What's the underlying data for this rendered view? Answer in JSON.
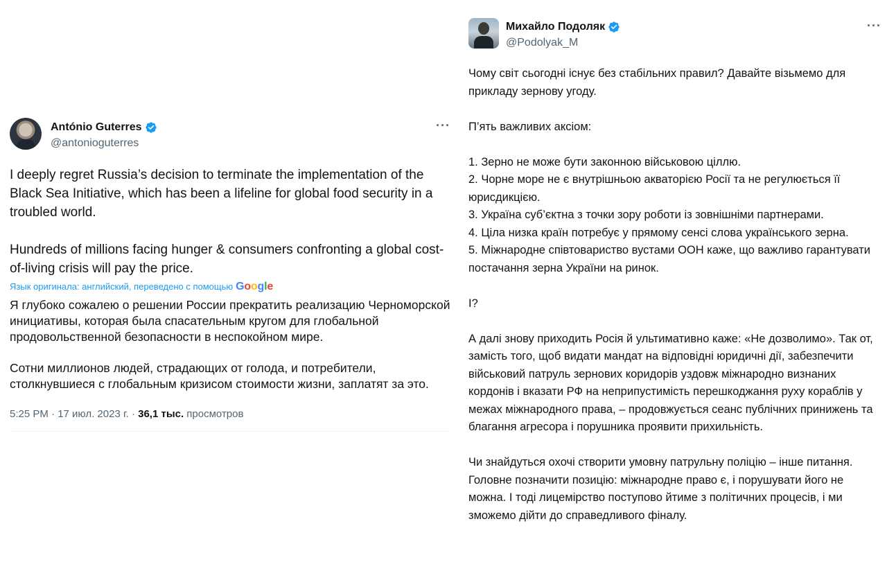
{
  "left_tweet": {
    "name": "António Guterres",
    "handle": "@antonioguterres",
    "more": "···",
    "para1": "I deeply regret Russia’s decision to terminate the implementation of the Black Sea Initiative, which has been a lifeline for global food security in a troubled world.",
    "para2": "Hundreds of millions facing hunger & consumers confronting a global cost-of-living crisis will pay the price.",
    "translate_note": "Язык оригинала: английский, переведено с помощью",
    "translate_brand": "Google",
    "ru_para1": "Я глубоко сожалею о решении России прекратить реализацию Черноморской инициативы, которая была спасательным кругом для глобальной продовольственной безопасности в неспокойном мире.",
    "ru_para2": "Сотни миллионов людей, страдающих от голода, и потребители, столкнувшиеся с глобальным кризисом стоимости жизни, заплатят за это.",
    "time": "5:25 PM · 17 июл. 2023 г. · ",
    "views_count": "36,1 тыс.",
    "views_label": " просмотров"
  },
  "right_tweet": {
    "name": "Михайло Подоляк",
    "handle": "@Podolyak_M",
    "more": "···",
    "intro": "Чому світ сьогодні існує без стабільних правил? Давайте візьмемо для прикладу зернову угоду.",
    "axioms_title": "П’ять важливих аксіом:",
    "axioms": [
      "1. Зерно не може бути законною військовою ціллю.",
      "2. Чорне море не є внутрішньою акваторією Росії та не регулюється її юрисдикцією.",
      "3. Україна суб’єктна з точки зору роботи із зовнішніми партнерами.",
      "4. Ціла низка країн потребує у прямому сенсі слова українського зерна.",
      "5. Міжнародне співтовариство вустами ООН каже, що важливо гарантувати постачання зерна України на ринок."
    ],
    "question": "І?",
    "para_russia": "А далі знову приходить Росія й ультимативно каже: «Не дозволимо». Так от, замість того, щоб видати мандат на відповідні юридичні дії, забезпечити військовий патруль зернових коридорів уздовж міжнародно визнаних кордонів і вказати РФ на неприпустимість перешкоджання руху кораблів у межах міжнародного права, – продовжується сеанс публічних принижень та благання агресора і порушника проявити прихильність.",
    "para_final": "Чи знайдуться охочі створити умовну патрульну поліцію – інше питання. Головне позначити позицію: міжнародне право є, і порушувати його не можна. І тоді лицемірство поступово йтиме з політичних процесів, і ми зможемо дійти до справедливого фіналу."
  },
  "colors": {
    "verified_badge": "#1d9bf0",
    "link": "#1d9bf0",
    "secondary_text": "#536471",
    "primary_text": "#0f1419"
  }
}
